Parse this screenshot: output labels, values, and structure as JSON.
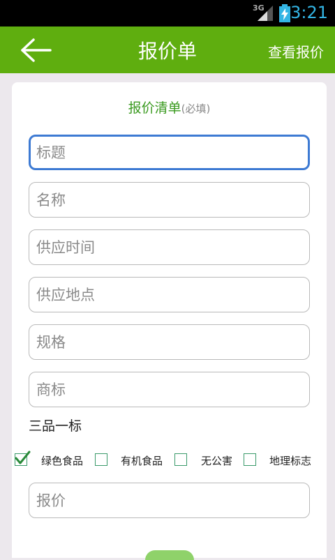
{
  "status": {
    "network": "3G",
    "time": "3:21"
  },
  "app_bar": {
    "title": "报价单",
    "action": "查看报价"
  },
  "form": {
    "heading": "报价清单",
    "heading_note": "(必填)",
    "fields": [
      {
        "placeholder": "标题"
      },
      {
        "placeholder": "名称"
      },
      {
        "placeholder": "供应时间"
      },
      {
        "placeholder": "供应地点"
      },
      {
        "placeholder": "规格"
      },
      {
        "placeholder": "商标"
      }
    ],
    "certification_label": "三品一标",
    "checkboxes": [
      {
        "label": "绿色食品",
        "checked": true
      },
      {
        "label": "有机食品",
        "checked": false
      },
      {
        "label": "无公害",
        "checked": false
      },
      {
        "label": "地理标志",
        "checked": false
      }
    ],
    "price_field": {
      "placeholder": "报价"
    }
  }
}
